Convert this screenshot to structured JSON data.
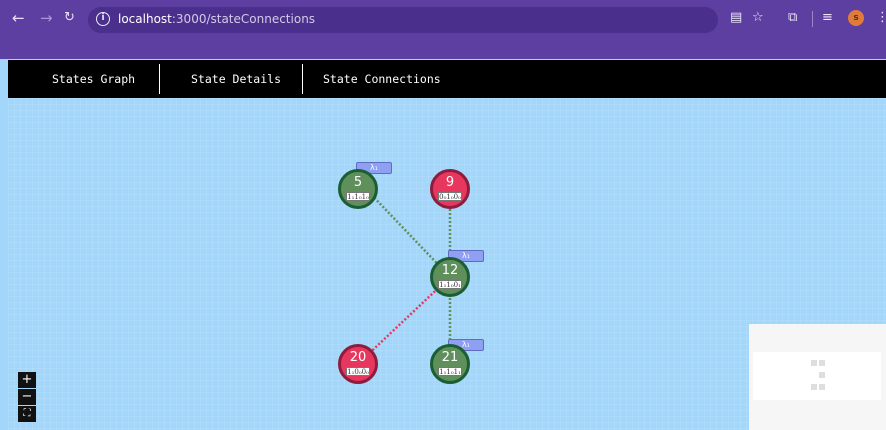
{
  "browser": {
    "url_host": "localhost",
    "url_path": ":3000/stateConnections",
    "profile_initial": "s"
  },
  "nav": {
    "tabs": [
      {
        "label": "States Graph"
      },
      {
        "label": "State Details"
      },
      {
        "label": "State Connections"
      }
    ]
  },
  "graph": {
    "nodes": [
      {
        "id": "5",
        "label": "5",
        "state": "1₁1₀1₀",
        "color": "green",
        "badge": "λ₁"
      },
      {
        "id": "9",
        "label": "9",
        "state": "0₀1₀0₀",
        "color": "red"
      },
      {
        "id": "12",
        "label": "12",
        "state": "1₁1₀0₁",
        "color": "green",
        "badge": "λ₁"
      },
      {
        "id": "20",
        "label": "20",
        "state": "1₁0₀0₀",
        "color": "red"
      },
      {
        "id": "21",
        "label": "21",
        "state": "1₁1₀1₁",
        "color": "green",
        "badge": "λ₁"
      }
    ],
    "edges": [
      {
        "from": "5",
        "to": "12",
        "style": "green"
      },
      {
        "from": "9",
        "to": "12",
        "style": "green"
      },
      {
        "from": "20",
        "to": "12",
        "style": "red"
      },
      {
        "from": "21",
        "to": "12",
        "style": "green"
      }
    ],
    "colors": {
      "green_node": "#5f8f5b",
      "red_node": "#e8375f",
      "badge": "#8fa0f2",
      "edge_green": "#5f8f5b",
      "edge_red": "#e8375f"
    }
  },
  "zoom_controls": {
    "zoom_in": "+",
    "zoom_out": "−",
    "fit": "⛶"
  }
}
